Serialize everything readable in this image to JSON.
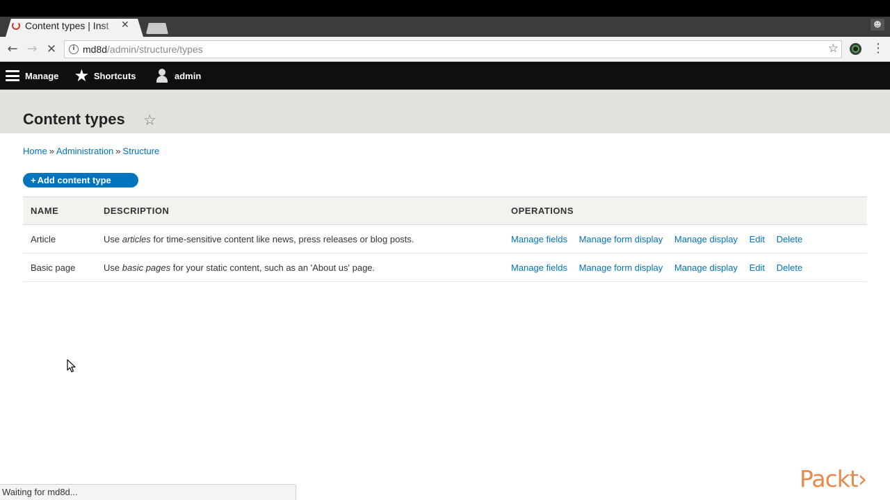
{
  "browser": {
    "tab_title": "Content types | Inst",
    "close_glyph": "✕",
    "url_host": "md8d",
    "url_path": "/admin/structure/types",
    "status_text": "Waiting for md8d..."
  },
  "toolbar": {
    "manage_label": "Manage",
    "shortcuts_label": "Shortcuts",
    "user_label": "admin"
  },
  "page": {
    "title": "Content types",
    "breadcrumb": [
      "Home",
      "Administration",
      "Structure"
    ],
    "add_button_label": "Add content type"
  },
  "table": {
    "headers": [
      "NAME",
      "DESCRIPTION",
      "OPERATIONS"
    ],
    "rows": [
      {
        "name": "Article",
        "desc_before": "Use ",
        "desc_em": "articles",
        "desc_after": " for time-sensitive content like news, press releases or blog posts.",
        "ops": [
          "Manage fields",
          "Manage form display",
          "Manage display",
          "Edit",
          "Delete"
        ]
      },
      {
        "name": "Basic page",
        "desc_before": "Use ",
        "desc_em": "basic pages",
        "desc_after": " for your static content, such as an 'About us' page.",
        "ops": [
          "Manage fields",
          "Manage form display",
          "Manage display",
          "Edit",
          "Delete"
        ]
      }
    ]
  },
  "watermark": "Packt›",
  "colors": {
    "link": "#0074bd",
    "header_bg": "#e1e2dc",
    "toolbar_bg": "#0f0f0f",
    "watermark": "#e8884a"
  }
}
